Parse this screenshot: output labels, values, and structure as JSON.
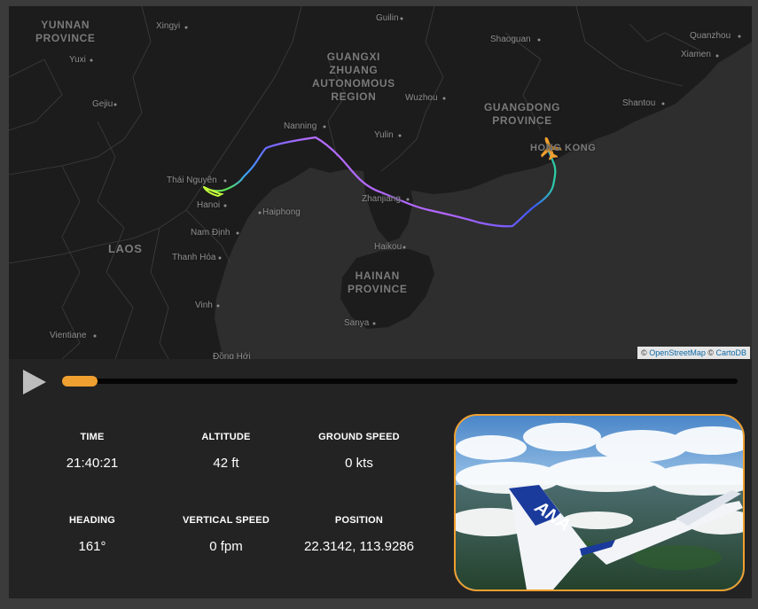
{
  "map": {
    "labels": [
      {
        "id": "yunnan",
        "text": "YUNNAN\nPROVINCE",
        "kind": "region"
      },
      {
        "id": "guangxi",
        "text": "GUANGXI\nZHUANG\nAUTONOMOUS\nREGION",
        "kind": "region"
      },
      {
        "id": "guangdong",
        "text": "GUANGDONG\nPROVINCE",
        "kind": "region"
      },
      {
        "id": "hainan",
        "text": "HAINAN\nPROVINCE",
        "kind": "region"
      },
      {
        "id": "laos",
        "text": "LAOS",
        "kind": "region"
      },
      {
        "id": "hongkong",
        "text": "HONG KONG",
        "kind": "region"
      },
      {
        "id": "xingyi",
        "text": "Xingyi",
        "kind": "city"
      },
      {
        "id": "guilin",
        "text": "Guilin",
        "kind": "city"
      },
      {
        "id": "shaoguan",
        "text": "Shaoguan",
        "kind": "city"
      },
      {
        "id": "quanzhou",
        "text": "Quanzhou",
        "kind": "city"
      },
      {
        "id": "xiamen",
        "text": "Xiamen",
        "kind": "city"
      },
      {
        "id": "yuxi",
        "text": "Yuxi",
        "kind": "city"
      },
      {
        "id": "gejiu",
        "text": "Gejiu",
        "kind": "city"
      },
      {
        "id": "wuzhou",
        "text": "Wuzhou",
        "kind": "city"
      },
      {
        "id": "shantou",
        "text": "Shantou",
        "kind": "city"
      },
      {
        "id": "nanning",
        "text": "Nanning",
        "kind": "city"
      },
      {
        "id": "yulin",
        "text": "Yulin",
        "kind": "city"
      },
      {
        "id": "thainguyen",
        "text": "Thái Nguyên",
        "kind": "city"
      },
      {
        "id": "hanoi",
        "text": "Hanoi",
        "kind": "city"
      },
      {
        "id": "haiphong",
        "text": "Haiphong",
        "kind": "city"
      },
      {
        "id": "zhanjiang",
        "text": "Zhanjiang",
        "kind": "city"
      },
      {
        "id": "namdinh",
        "text": "Nam Định",
        "kind": "city"
      },
      {
        "id": "thanhhoa",
        "text": "Thanh Hóa",
        "kind": "city"
      },
      {
        "id": "haikou",
        "text": "Haikou",
        "kind": "city"
      },
      {
        "id": "vinh",
        "text": "Vinh",
        "kind": "city"
      },
      {
        "id": "sanya",
        "text": "Sanya",
        "kind": "city"
      },
      {
        "id": "vientiane",
        "text": "Vientiane",
        "kind": "city"
      },
      {
        "id": "donghoi",
        "text": "Đồng Hới",
        "kind": "city"
      }
    ],
    "attribution": {
      "prefix": "© ",
      "osm": "OpenStreetMap",
      "mid": " © ",
      "carto": "CartoDB"
    }
  },
  "playback": {
    "progress": 0.053
  },
  "stats": {
    "time": {
      "label": "TIME",
      "value": "21:40:21"
    },
    "altitude": {
      "label": "ALTITUDE",
      "value": "42 ft"
    },
    "ground_speed": {
      "label": "GROUND SPEED",
      "value": "0 kts"
    },
    "heading": {
      "label": "HEADING",
      "value": "161°"
    },
    "vertical_speed": {
      "label": "VERTICAL SPEED",
      "value": "0 fpm"
    },
    "position": {
      "label": "POSITION",
      "value": "22.3142, 113.9286"
    }
  },
  "colors": {
    "accent": "#f0a030",
    "track_start": "#2bd33a",
    "track_end": "#b266ff",
    "aircraft": "#f0a030"
  },
  "icons": {
    "play": "play-icon",
    "aircraft": "airplane-icon"
  }
}
